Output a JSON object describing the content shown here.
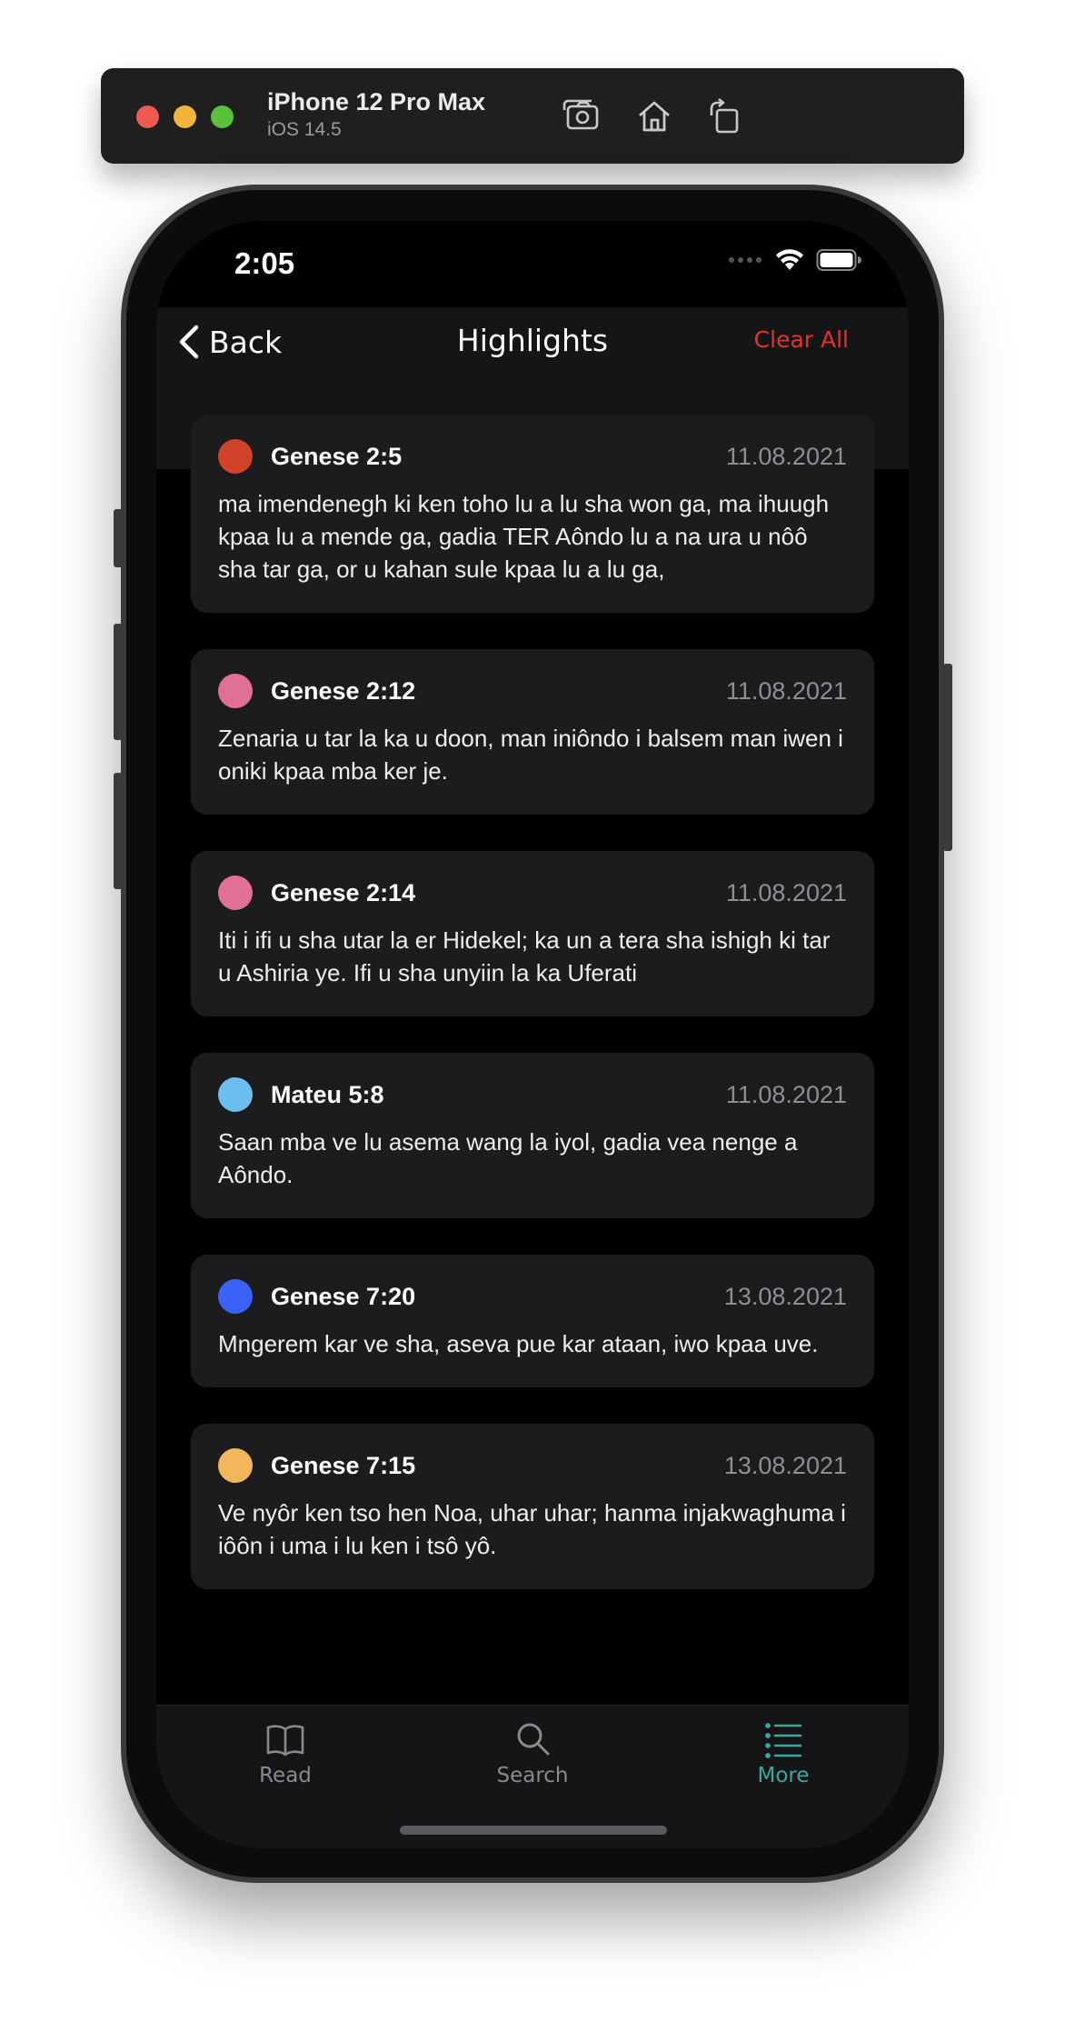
{
  "simulator": {
    "device": "iPhone 12 Pro Max",
    "os": "iOS 14.5",
    "icons": [
      "screenshot-icon",
      "home-icon",
      "rotate-icon"
    ]
  },
  "status_bar": {
    "time": "2:05"
  },
  "nav": {
    "back_label": "Back",
    "title": "Highlights",
    "clear_label": "Clear All",
    "clear_color": "#e0342c"
  },
  "highlights": [
    {
      "ref": "Genese 2:5",
      "date": "11.08.2021",
      "color": "#d0432a",
      "text": "ma imendenegh ki ken toho lu a lu sha won ga, ma ihuugh kpaa lu a mende ga, gadia TER Aôndo lu a na ura u nôô sha tar ga, or u kahan sule kpaa lu a lu ga,"
    },
    {
      "ref": "Genese 2:12",
      "date": "11.08.2021",
      "color": "#e07096",
      "text": "Zenaria u tar la ka u doon, man iniôndo i balsem man iwen i oniki kpaa mba ker je."
    },
    {
      "ref": "Genese 2:14",
      "date": "11.08.2021",
      "color": "#e07096",
      "text": "Iti i ifi u sha utar la er Hidekel; ka un a tera sha ishigh ki tar u Ashiria ye. Ifi u sha unyiin la ka Uferati"
    },
    {
      "ref": "Mateu 5:8",
      "date": "11.08.2021",
      "color": "#6cbdf0",
      "text": "Saan mba ve lu asema wang la iyol, gadia vea nenge a Aôndo."
    },
    {
      "ref": "Genese 7:20",
      "date": "13.08.2021",
      "color": "#3b62f5",
      "text": "Mngerem kar ve sha, aseva pue kar ataan, iwo kpaa uve."
    },
    {
      "ref": "Genese 7:15",
      "date": "13.08.2021",
      "color": "#f2b65c",
      "text": "Ve nyôr ken tso hen Noa, uhar uhar; hanma injakwaghuma i iôôn i uma i lu ken i tsô yô."
    }
  ],
  "tabs": [
    {
      "label": "Read",
      "icon": "book-icon",
      "active": false
    },
    {
      "label": "Search",
      "icon": "search-icon",
      "active": false
    },
    {
      "label": "More",
      "icon": "list-icon",
      "active": true
    }
  ],
  "colors": {
    "accent": "#3aa8a0",
    "card_bg": "#1c1c1e",
    "background": "#000000"
  }
}
